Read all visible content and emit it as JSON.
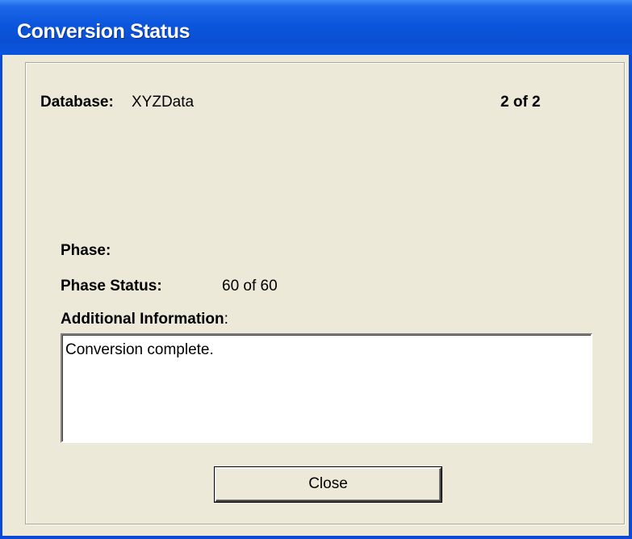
{
  "window": {
    "title": "Conversion Status"
  },
  "database": {
    "label": "Database:",
    "value": "XYZData",
    "progress": "2 of 2"
  },
  "phase": {
    "label": "Phase:",
    "value": ""
  },
  "phase_status": {
    "label": "Phase Status:",
    "value": "60 of 60"
  },
  "additional_info": {
    "label": "Additional Information",
    "colon": ":",
    "text": "Conversion complete."
  },
  "buttons": {
    "close_label": "Close"
  },
  "colors": {
    "titlebar": "#0a4fd2",
    "dialog_bg": "#ece9d8"
  }
}
